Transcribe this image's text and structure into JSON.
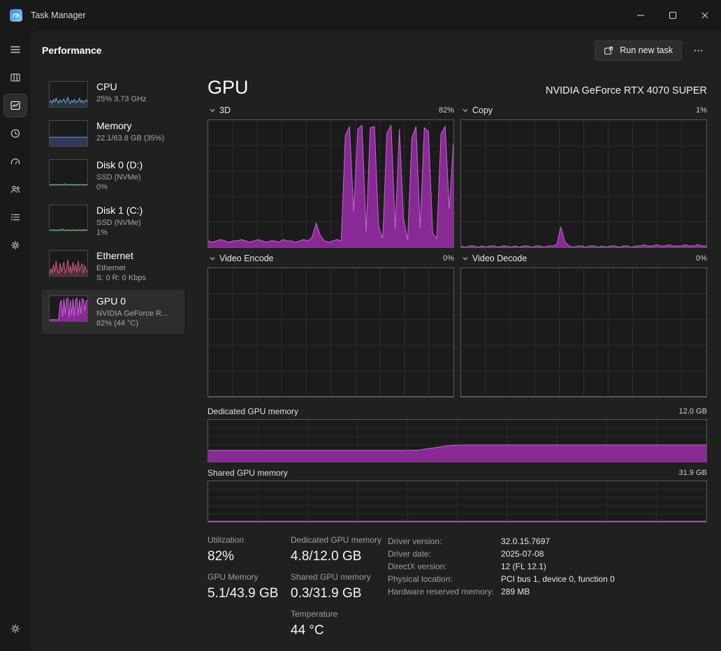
{
  "window": {
    "title": "Task Manager"
  },
  "header": {
    "title": "Performance",
    "run_new_task": "Run new task"
  },
  "nav": {
    "items": [
      "menu",
      "processes",
      "performance",
      "app-history",
      "startup-apps",
      "users",
      "details",
      "services"
    ],
    "selected": "performance",
    "bottom": "settings"
  },
  "sidebar": {
    "items": [
      {
        "name": "CPU",
        "sub1": "25% 3.73 GHz",
        "sub2": ""
      },
      {
        "name": "Memory",
        "sub1": "22.1/63.8 GB (35%)",
        "sub2": ""
      },
      {
        "name": "Disk 0 (D:)",
        "sub1": "SSD (NVMe)",
        "sub2": "0%"
      },
      {
        "name": "Disk 1 (C:)",
        "sub1": "SSD (NVMe)",
        "sub2": "1%"
      },
      {
        "name": "Ethernet",
        "sub1": "Ethernet",
        "sub2": "S: 0 R: 0 Kbps"
      },
      {
        "name": "GPU 0",
        "sub1": "NVIDIA GeForce R...",
        "sub2": "82% (44 °C)"
      }
    ]
  },
  "main": {
    "title": "GPU",
    "device": "NVIDIA GeForce RTX 4070 SUPER",
    "usage_charts": [
      {
        "label": "3D",
        "value": "82%"
      },
      {
        "label": "Copy",
        "value": "1%"
      },
      {
        "label": "Video Encode",
        "value": "0%"
      },
      {
        "label": "Video Decode",
        "value": "0%"
      }
    ],
    "memory_charts": [
      {
        "label": "Dedicated GPU memory",
        "value": "12.0 GB"
      },
      {
        "label": "Shared GPU memory",
        "value": "31.9 GB"
      }
    ],
    "stats": {
      "utilization": {
        "label": "Utilization",
        "value": "82%"
      },
      "gpu_memory": {
        "label": "GPU Memory",
        "value": "5.1/43.9 GB"
      },
      "dedicated": {
        "label": "Dedicated GPU memory",
        "value": "4.8/12.0 GB"
      },
      "shared": {
        "label": "Shared GPU memory",
        "value": "0.3/31.9 GB"
      },
      "temperature": {
        "label": "Temperature",
        "value": "44 °C"
      }
    },
    "details": [
      {
        "label": "Driver version:",
        "value": "32.0.15.7697"
      },
      {
        "label": "Driver date:",
        "value": "2025-07-08"
      },
      {
        "label": "DirectX version:",
        "value": "12 (FL 12.1)"
      },
      {
        "label": "Physical location:",
        "value": "PCI bus 1, device 0, function 0"
      },
      {
        "label": "Hardware reserved memory:",
        "value": "289 MB"
      }
    ]
  },
  "colors": {
    "gpu_accent": "#8f2a9d",
    "gpu_line": "#c468d2",
    "grid": "#2e2e2e",
    "chart_border": "#585858"
  },
  "chart_data": {
    "gpu_3d": {
      "type": "area",
      "grid": true,
      "ymax": 100,
      "fill": "rgba(143,42,157,0.95)",
      "stroke": "#c468d2",
      "values": [
        5,
        4,
        5,
        6,
        5,
        4,
        5,
        5,
        6,
        5,
        4,
        5,
        6,
        5,
        4,
        5,
        5,
        4,
        6,
        5,
        5,
        4,
        5,
        6,
        5,
        8,
        19,
        9,
        5,
        4,
        5,
        6,
        5,
        88,
        95,
        28,
        93,
        96,
        12,
        94,
        95,
        16,
        7,
        90,
        96,
        14,
        93,
        22,
        6,
        86,
        95,
        15,
        94,
        91,
        11,
        7,
        89,
        95,
        30,
        82
      ]
    },
    "gpu_copy": {
      "type": "area",
      "grid": true,
      "ymax": 100,
      "fill": "rgba(143,42,157,0.95)",
      "stroke": "#c468d2",
      "values": [
        1,
        0,
        1,
        1,
        0,
        1,
        0,
        1,
        1,
        0,
        1,
        1,
        0,
        1,
        0,
        1,
        1,
        0,
        1,
        1,
        0,
        1,
        1,
        2,
        16,
        4,
        1,
        0,
        1,
        1,
        0,
        1,
        1,
        0,
        1,
        0,
        1,
        1,
        0,
        1,
        1,
        0,
        1,
        1,
        2,
        1,
        1,
        2,
        1,
        1,
        2,
        1,
        1,
        1,
        2,
        1,
        1,
        2,
        1,
        1
      ]
    },
    "video_encode": {
      "type": "area",
      "grid": true,
      "ymax": 100,
      "fill": "rgba(143,42,157,0.95)",
      "stroke": "#c468d2",
      "values": [
        0,
        0
      ]
    },
    "video_decode": {
      "type": "area",
      "grid": true,
      "ymax": 100,
      "fill": "rgba(143,42,157,0.95)",
      "stroke": "#c468d2",
      "values": [
        0,
        0
      ]
    },
    "dedicated_memory": {
      "type": "area",
      "grid": true,
      "ymax": 100,
      "fill": "rgba(143,42,157,0.95)",
      "stroke": "#c468d2",
      "values": [
        27,
        27,
        27,
        27,
        27,
        27,
        27,
        27,
        27,
        27,
        27,
        27,
        27,
        27,
        27,
        27,
        27,
        27,
        27,
        27,
        27,
        27,
        27,
        27,
        27,
        28,
        31,
        34,
        37,
        39,
        40,
        40,
        40,
        40,
        40,
        40,
        40,
        40,
        40,
        40,
        40,
        40,
        40,
        40,
        40,
        40,
        40,
        40,
        40,
        40,
        40,
        40,
        40,
        40,
        40,
        40,
        40,
        40,
        40,
        40
      ]
    },
    "shared_memory": {
      "type": "area",
      "grid": true,
      "ymax": 100,
      "fill": "rgba(143,42,157,0.95)",
      "stroke": "#c468d2",
      "values": [
        1.2,
        1.2
      ]
    },
    "thumb_cpu": {
      "type": "area",
      "grid": false,
      "ymax": 100,
      "fill": "rgba(109,166,224,0.18)",
      "stroke": "#6da6e0",
      "values": [
        18,
        25,
        15,
        30,
        20,
        35,
        22,
        15,
        28,
        18,
        24,
        32,
        16,
        22,
        38,
        20,
        14,
        26,
        18,
        30,
        16,
        24,
        20,
        34,
        18,
        26,
        15,
        22,
        28,
        20
      ]
    },
    "thumb_memory": {
      "type": "area",
      "grid": false,
      "ymax": 100,
      "fill": "rgba(90,115,200,0.35)",
      "stroke": "#6f8fe8",
      "values": [
        35,
        35
      ]
    },
    "thumb_disk0": {
      "type": "area",
      "grid": false,
      "ymax": 100,
      "fill": "rgba(121,201,120,0.12)",
      "stroke": "#79c978",
      "values": [
        2,
        1,
        3,
        1,
        2,
        4,
        1,
        2,
        1,
        3,
        1,
        2,
        5,
        1,
        2,
        1,
        3,
        1,
        2,
        1,
        4,
        1,
        2,
        1,
        3,
        1,
        2,
        1,
        2,
        1
      ]
    },
    "thumb_disk1": {
      "type": "area",
      "grid": false,
      "ymax": 100,
      "fill": "rgba(121,201,120,0.12)",
      "stroke": "#79c978",
      "values": [
        1,
        2,
        1,
        4,
        1,
        2,
        1,
        3,
        1,
        2,
        6,
        1,
        2,
        1,
        3,
        1,
        2,
        1,
        4,
        1,
        2,
        1,
        3,
        1,
        2,
        1,
        5,
        1,
        2,
        1
      ]
    },
    "thumb_ethernet": {
      "type": "area",
      "grid": false,
      "ymax": 100,
      "fill": "rgba(207,93,126,0.3)",
      "stroke": "#cf5d7e",
      "values": [
        5,
        30,
        10,
        45,
        15,
        60,
        20,
        10,
        50,
        15,
        35,
        55,
        10,
        25,
        65,
        15,
        40,
        10,
        55,
        20,
        45,
        12,
        60,
        18,
        35,
        50,
        10,
        42,
        25,
        15
      ]
    },
    "thumb_gpu": {
      "type": "area",
      "grid": false,
      "ymax": 100,
      "fill": "rgba(143,42,157,0.95)",
      "stroke": "#c468d2",
      "values": [
        6,
        5,
        8,
        5,
        7,
        6,
        5,
        9,
        70,
        85,
        20,
        90,
        30,
        88,
        92,
        15,
        85,
        25,
        90,
        18,
        88,
        93,
        22,
        86,
        30,
        90,
        85,
        40,
        82,
        82
      ]
    }
  }
}
